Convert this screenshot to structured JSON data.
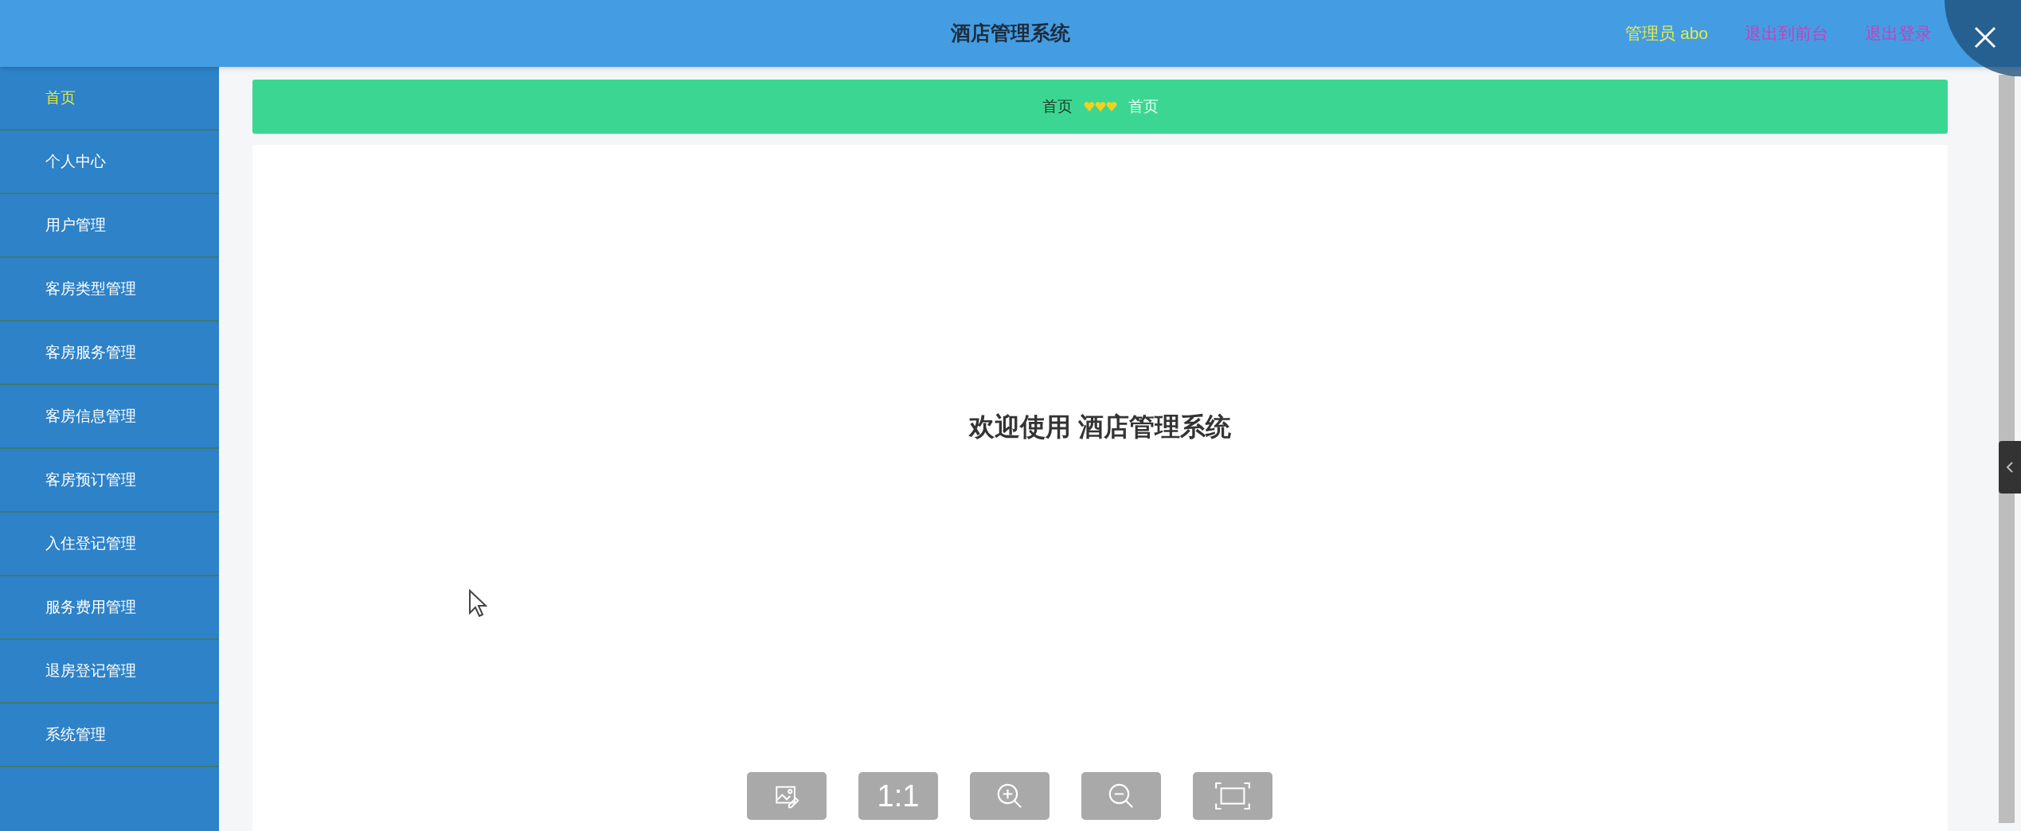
{
  "header": {
    "title": "酒店管理系统",
    "user": "管理员 abo",
    "links": [
      "退出到前台",
      "退出登录"
    ]
  },
  "sidebar": {
    "items": [
      {
        "label": "首页",
        "selected": true
      },
      {
        "label": "个人中心",
        "selected": false
      },
      {
        "label": "用户管理",
        "selected": false
      },
      {
        "label": "客房类型管理",
        "selected": false
      },
      {
        "label": "客房服务管理",
        "selected": false
      },
      {
        "label": "客房信息管理",
        "selected": false
      },
      {
        "label": "客房预订管理",
        "selected": false
      },
      {
        "label": "入住登记管理",
        "selected": false
      },
      {
        "label": "服务费用管理",
        "selected": false
      },
      {
        "label": "退房登记管理",
        "selected": false
      },
      {
        "label": "系统管理",
        "selected": false
      }
    ]
  },
  "breadcrumb": [
    "首页",
    "首页"
  ],
  "welcome": "欢迎使用 酒店管理系统",
  "viewer": {
    "buttons": [
      {
        "kind": "edit"
      },
      {
        "kind": "actual",
        "label": "1:1"
      },
      {
        "kind": "zoom-in"
      },
      {
        "kind": "zoom-out"
      },
      {
        "kind": "fit"
      }
    ]
  }
}
